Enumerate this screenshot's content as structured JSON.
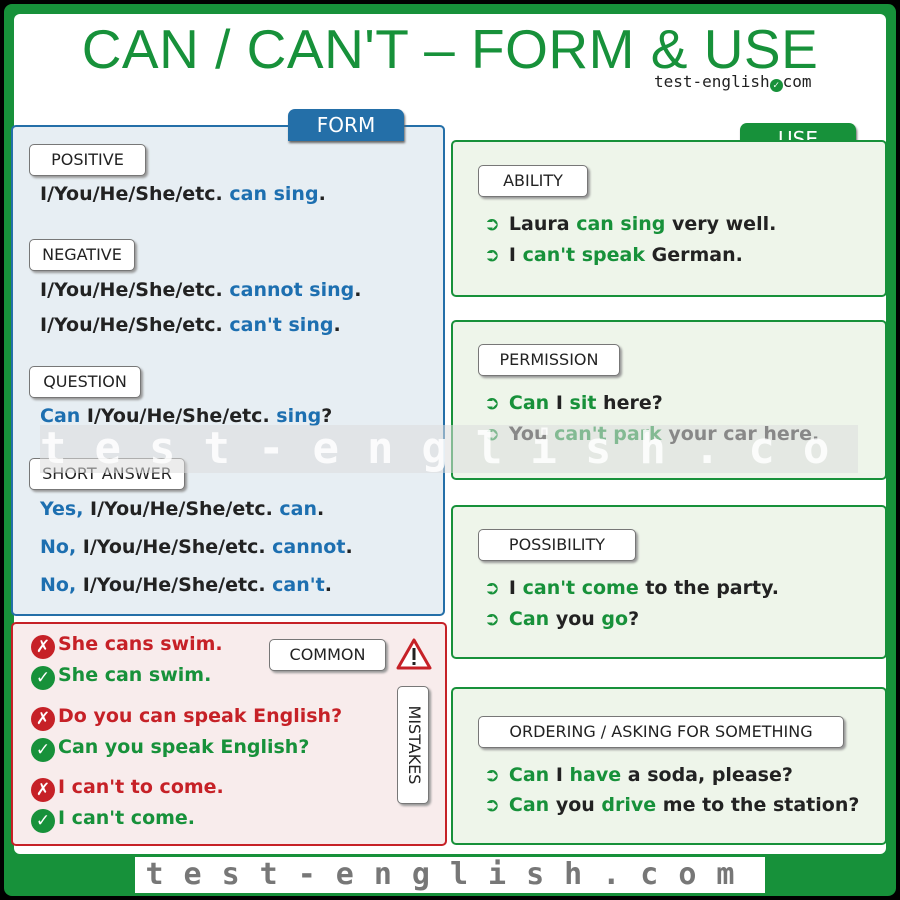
{
  "title": "CAN / CAN'T – FORM & USE",
  "brand": {
    "text": "test-english",
    "suffix": "com"
  },
  "form": {
    "header": "FORM",
    "positive": {
      "label": "POSITIVE",
      "lines": [
        [
          "I/You/He/She/etc. ",
          "can sing",
          "."
        ]
      ]
    },
    "negative": {
      "label": "NEGATIVE",
      "lines": [
        [
          "I/You/He/She/etc. ",
          "cannot sing",
          "."
        ],
        [
          "I/You/He/She/etc. ",
          "can't sing",
          "."
        ]
      ]
    },
    "question": {
      "label": "QUESTION",
      "lines": [
        [
          "Can",
          " I/You/He/She/etc. ",
          "sing",
          "?"
        ]
      ]
    },
    "short_answer": {
      "label": "SHORT ANSWER",
      "lines": [
        [
          "Yes,",
          " I/You/He/She/etc. ",
          "can",
          "."
        ],
        [
          "No,",
          " I/You/He/She/etc. ",
          "cannot",
          "."
        ],
        [
          "No,",
          " I/You/He/She/etc. ",
          "can't",
          "."
        ]
      ]
    }
  },
  "mistakes": {
    "label_top": "COMMON",
    "label_side": "MISTAKES",
    "items": [
      {
        "wrong": "She cans swim.",
        "right": "She can swim."
      },
      {
        "wrong": "Do you can speak English?",
        "right": "Can you speak English?"
      },
      {
        "wrong": "I can't to come.",
        "right": "I can't come."
      }
    ]
  },
  "use": {
    "header": "USE",
    "sections": [
      {
        "label": "ABILITY",
        "lines": [
          [
            [
              "Laura ",
              ""
            ],
            [
              "can sing",
              "g"
            ],
            [
              " very well.",
              ""
            ]
          ],
          [
            [
              "I ",
              ""
            ],
            [
              "can't speak",
              "g"
            ],
            [
              " German.",
              ""
            ]
          ]
        ]
      },
      {
        "label": "PERMISSION",
        "lines": [
          [
            [
              "Can",
              "g"
            ],
            [
              " I ",
              ""
            ],
            [
              "sit",
              "g"
            ],
            [
              " here?",
              ""
            ]
          ],
          [
            [
              "You ",
              ""
            ],
            [
              "can't park",
              "g"
            ],
            [
              " your car here.",
              ""
            ]
          ]
        ]
      },
      {
        "label": "POSSIBILITY",
        "lines": [
          [
            [
              "I ",
              ""
            ],
            [
              "can't come",
              "g"
            ],
            [
              " to the party.",
              ""
            ]
          ],
          [
            [
              "Can",
              "g"
            ],
            [
              " you ",
              ""
            ],
            [
              "go",
              "g"
            ],
            [
              "?",
              ""
            ]
          ]
        ]
      },
      {
        "label": "ORDERING / ASKING FOR SOMETHING",
        "lines": [
          [
            [
              "Can",
              "g"
            ],
            [
              " I ",
              ""
            ],
            [
              "have",
              "g"
            ],
            [
              " a soda, please?",
              ""
            ]
          ],
          [
            [
              "Can",
              "g"
            ],
            [
              " you ",
              ""
            ],
            [
              "drive",
              "g"
            ],
            [
              " me to the station?",
              ""
            ]
          ]
        ]
      }
    ]
  },
  "watermark": "test-english.com",
  "footer": "test-english.com",
  "colors": {
    "green": "#17913a",
    "blue": "#1d6fb0",
    "red": "#c62127"
  },
  "icons": [
    "check-circle-icon",
    "x-circle-icon",
    "warning-triangle-icon",
    "arrow-bullet-icon"
  ]
}
